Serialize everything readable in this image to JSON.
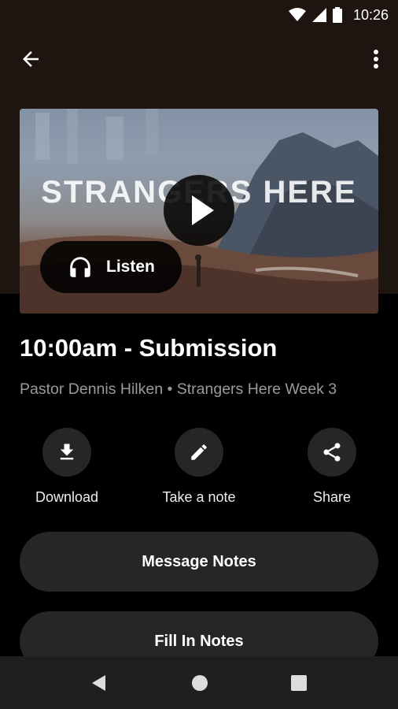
{
  "status_bar": {
    "time": "10:26",
    "icons": [
      "wifi-icon",
      "signal-icon",
      "battery-icon"
    ]
  },
  "toolbar": {
    "back_icon": "arrow-back-icon",
    "menu_icon": "more-vert-icon"
  },
  "hero": {
    "artwork_title": "STRANGERS HERE",
    "play_icon": "play-icon",
    "listen_label": "Listen",
    "listen_icon": "headphones-icon"
  },
  "sermon": {
    "title": "10:00am - Submission",
    "subtitle": "Pastor Dennis Hilken • Strangers Here Week 3"
  },
  "actions": [
    {
      "label": "Download",
      "icon": "download-icon"
    },
    {
      "label": "Take a note",
      "icon": "pencil-icon"
    },
    {
      "label": "Share",
      "icon": "share-icon"
    }
  ],
  "buttons": {
    "message_notes": "Message Notes",
    "fill_in_notes": "Fill In Notes"
  },
  "nav_bar": {
    "icons": [
      "nav-back-icon",
      "nav-home-icon",
      "nav-recents-icon"
    ]
  },
  "colors": {
    "header_background": "#1e1410",
    "surface": "#262626",
    "subtitle_text": "#9a9a9a"
  }
}
